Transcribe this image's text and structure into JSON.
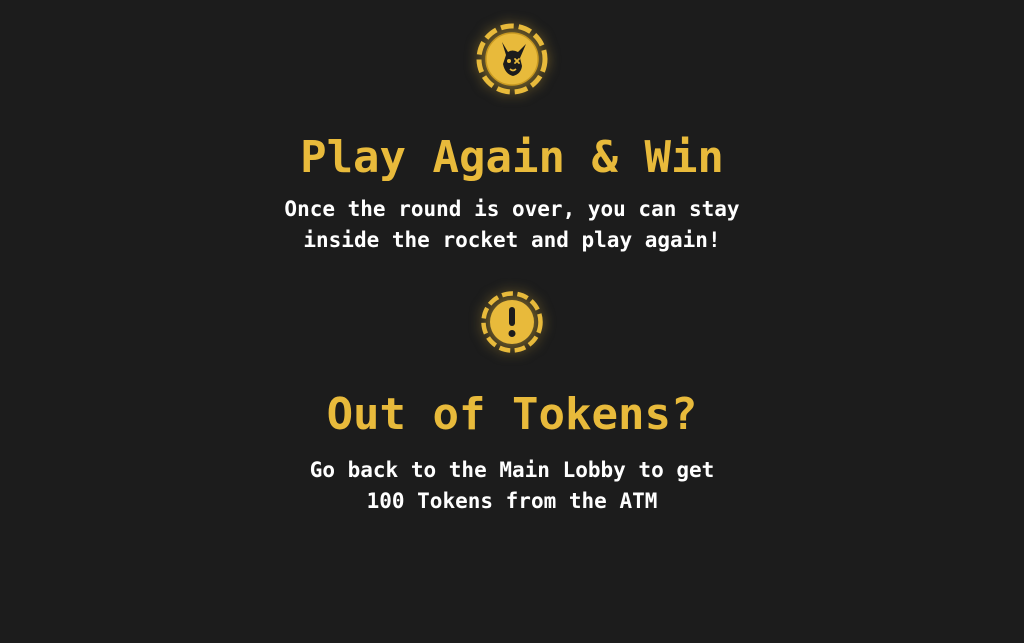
{
  "colors": {
    "background": "#1c1c1c",
    "accent": "#e8ba3b",
    "text": "#ffffff"
  },
  "section_play_again": {
    "icon": "kangaroo-chip-icon",
    "title": "Play Again & Win",
    "description_line_1": "Once the round is over, you can stay",
    "description_line_2": "inside the rocket and play again!"
  },
  "section_out_of_tokens": {
    "icon": "exclamation-chip-icon",
    "title": "Out of Tokens?",
    "description_line_1": "Go back to the Main Lobby to get",
    "description_line_2": "100 Tokens from the ATM"
  }
}
